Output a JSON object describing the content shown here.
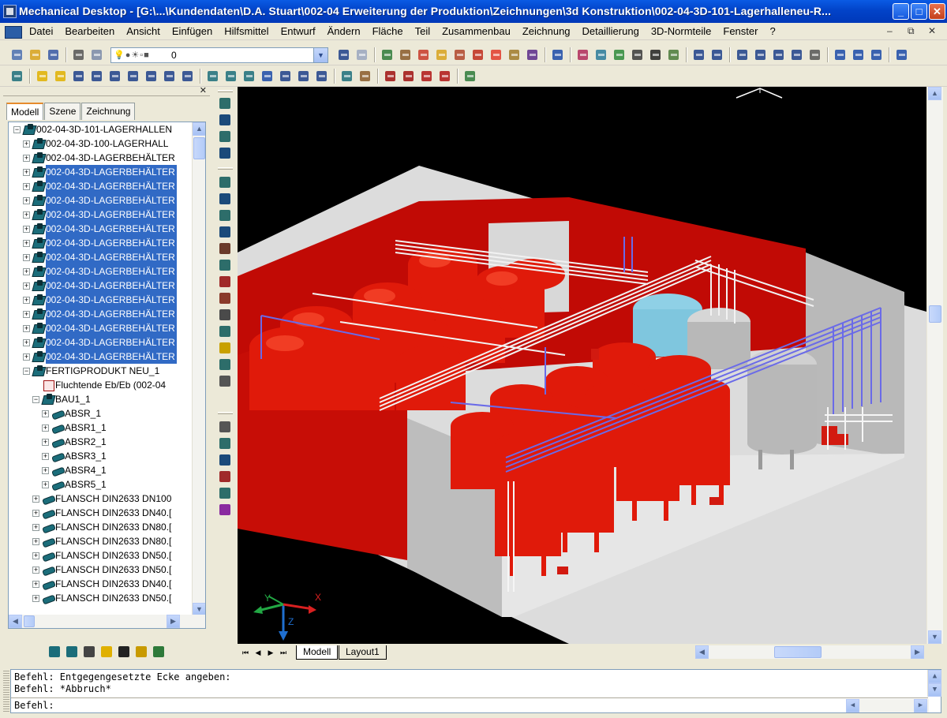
{
  "window": {
    "title": "Mechanical Desktop - [G:\\...\\Kundendaten\\D.A. Stuart\\002-04 Erweiterung der Produktion\\Zeichnungen\\3d Konstruktion\\002-04-3D-101-Lagerhalleneu-R...",
    "controls": {
      "minimize": "_",
      "maximize": "□",
      "close": "✕"
    }
  },
  "menu": {
    "items": [
      "Datei",
      "Bearbeiten",
      "Ansicht",
      "Einfügen",
      "Hilfsmittel",
      "Entwurf",
      "Ändern",
      "Fläche",
      "Teil",
      "Zusammenbau",
      "Zeichnung",
      "Detaillierung",
      "3D-Normteile",
      "Fenster",
      "?"
    ],
    "doc_controls": {
      "minimize": "–",
      "restore": "⧉",
      "close": "✕"
    }
  },
  "layer_combo": {
    "glyphs": "💡●☀▫■",
    "value": "0"
  },
  "browser": {
    "close": "✕",
    "tabs": [
      "Modell",
      "Szene",
      "Zeichnung"
    ],
    "active_tab": "Modell",
    "tree": [
      {
        "indent": 0,
        "exp": "−",
        "icon": "asm",
        "label": "002-04-3D-101-LAGERHALLEN",
        "selected": false
      },
      {
        "indent": 1,
        "exp": "+",
        "icon": "asm",
        "label": "002-04-3D-100-LAGERHALL",
        "selected": false
      },
      {
        "indent": 1,
        "exp": "+",
        "icon": "asm",
        "label": "002-04-3D-LAGERBEHÄLTER",
        "selected": false
      },
      {
        "indent": 1,
        "exp": "+",
        "icon": "asm",
        "label": "002-04-3D-LAGERBEHÄLTER",
        "selected": true
      },
      {
        "indent": 1,
        "exp": "+",
        "icon": "asm",
        "label": "002-04-3D-LAGERBEHÄLTER",
        "selected": true
      },
      {
        "indent": 1,
        "exp": "+",
        "icon": "asm",
        "label": "002-04-3D-LAGERBEHÄLTER",
        "selected": true
      },
      {
        "indent": 1,
        "exp": "+",
        "icon": "asm",
        "label": "002-04-3D-LAGERBEHÄLTER",
        "selected": true
      },
      {
        "indent": 1,
        "exp": "+",
        "icon": "asm",
        "label": "002-04-3D-LAGERBEHÄLTER",
        "selected": true
      },
      {
        "indent": 1,
        "exp": "+",
        "icon": "asm",
        "label": "002-04-3D-LAGERBEHÄLTER",
        "selected": true
      },
      {
        "indent": 1,
        "exp": "+",
        "icon": "asm",
        "label": "002-04-3D-LAGERBEHÄLTER",
        "selected": true
      },
      {
        "indent": 1,
        "exp": "+",
        "icon": "asm",
        "label": "002-04-3D-LAGERBEHÄLTER",
        "selected": true
      },
      {
        "indent": 1,
        "exp": "+",
        "icon": "asm",
        "label": "002-04-3D-LAGERBEHÄLTER",
        "selected": true
      },
      {
        "indent": 1,
        "exp": "+",
        "icon": "asm",
        "label": "002-04-3D-LAGERBEHÄLTER",
        "selected": true
      },
      {
        "indent": 1,
        "exp": "+",
        "icon": "asm",
        "label": "002-04-3D-LAGERBEHÄLTER",
        "selected": true
      },
      {
        "indent": 1,
        "exp": "+",
        "icon": "asm",
        "label": "002-04-3D-LAGERBEHÄLTER",
        "selected": true
      },
      {
        "indent": 1,
        "exp": "+",
        "icon": "asm",
        "label": "002-04-3D-LAGERBEHÄLTER",
        "selected": true
      },
      {
        "indent": 1,
        "exp": "+",
        "icon": "asm",
        "label": "002-04-3D-LAGERBEHÄLTER",
        "selected": true
      },
      {
        "indent": 1,
        "exp": "−",
        "icon": "asm",
        "label": "FERTIGPRODUKT NEU_1",
        "selected": false
      },
      {
        "indent": 2,
        "exp": "",
        "icon": "drw",
        "label": "Fluchtende Eb/Eb (002-04",
        "selected": false
      },
      {
        "indent": 2,
        "exp": "−",
        "icon": "asm",
        "label": "BAU1_1",
        "selected": false
      },
      {
        "indent": 3,
        "exp": "+",
        "icon": "part",
        "label": "ABSR_1",
        "selected": false
      },
      {
        "indent": 3,
        "exp": "+",
        "icon": "part",
        "label": "ABSR1_1",
        "selected": false
      },
      {
        "indent": 3,
        "exp": "+",
        "icon": "part",
        "label": "ABSR2_1",
        "selected": false
      },
      {
        "indent": 3,
        "exp": "+",
        "icon": "part",
        "label": "ABSR3_1",
        "selected": false
      },
      {
        "indent": 3,
        "exp": "+",
        "icon": "part",
        "label": "ABSR4_1",
        "selected": false
      },
      {
        "indent": 3,
        "exp": "+",
        "icon": "part",
        "label": "ABSR5_1",
        "selected": false
      },
      {
        "indent": 2,
        "exp": "+",
        "icon": "part",
        "label": "FLANSCH DIN2633 DN100",
        "selected": false
      },
      {
        "indent": 2,
        "exp": "+",
        "icon": "part",
        "label": "FLANSCH DIN2633 DN40.[",
        "selected": false
      },
      {
        "indent": 2,
        "exp": "+",
        "icon": "part",
        "label": "FLANSCH DIN2633 DN80.[",
        "selected": false
      },
      {
        "indent": 2,
        "exp": "+",
        "icon": "part",
        "label": "FLANSCH DIN2633 DN80.[",
        "selected": false
      },
      {
        "indent": 2,
        "exp": "+",
        "icon": "part",
        "label": "FLANSCH DIN2633 DN50.[",
        "selected": false
      },
      {
        "indent": 2,
        "exp": "+",
        "icon": "part",
        "label": "FLANSCH DIN2633 DN50.[",
        "selected": false
      },
      {
        "indent": 2,
        "exp": "+",
        "icon": "part",
        "label": "FLANSCH DIN2633 DN40.[",
        "selected": false
      },
      {
        "indent": 2,
        "exp": "+",
        "icon": "part",
        "label": "FLANSCH DIN2633 DN50.[",
        "selected": false
      }
    ]
  },
  "viewport": {
    "ucs": {
      "x": "X",
      "y": "Y",
      "z": "Z"
    },
    "colors": {
      "tank": "#e01a0a",
      "tank_highlight": "#ff4a2a",
      "wall": "#c9c9c9",
      "floor": "#e0e0e0",
      "hall_wall": "#c70d06",
      "pipe_blue": "#6a6ae8",
      "tank_blue": "#7fc6de",
      "tank_grey": "#b8b8b8"
    }
  },
  "layout_tabs": {
    "nav": [
      "⏮",
      "◀",
      "▶",
      "⏭"
    ],
    "tabs": [
      "Modell",
      "Layout1"
    ],
    "active": "Modell"
  },
  "command": {
    "lines": [
      "Befehl: Entgegengesetzte Ecke angeben:",
      "Befehl: *Abbruch*"
    ],
    "prompt": "Befehl:",
    "input": ""
  }
}
